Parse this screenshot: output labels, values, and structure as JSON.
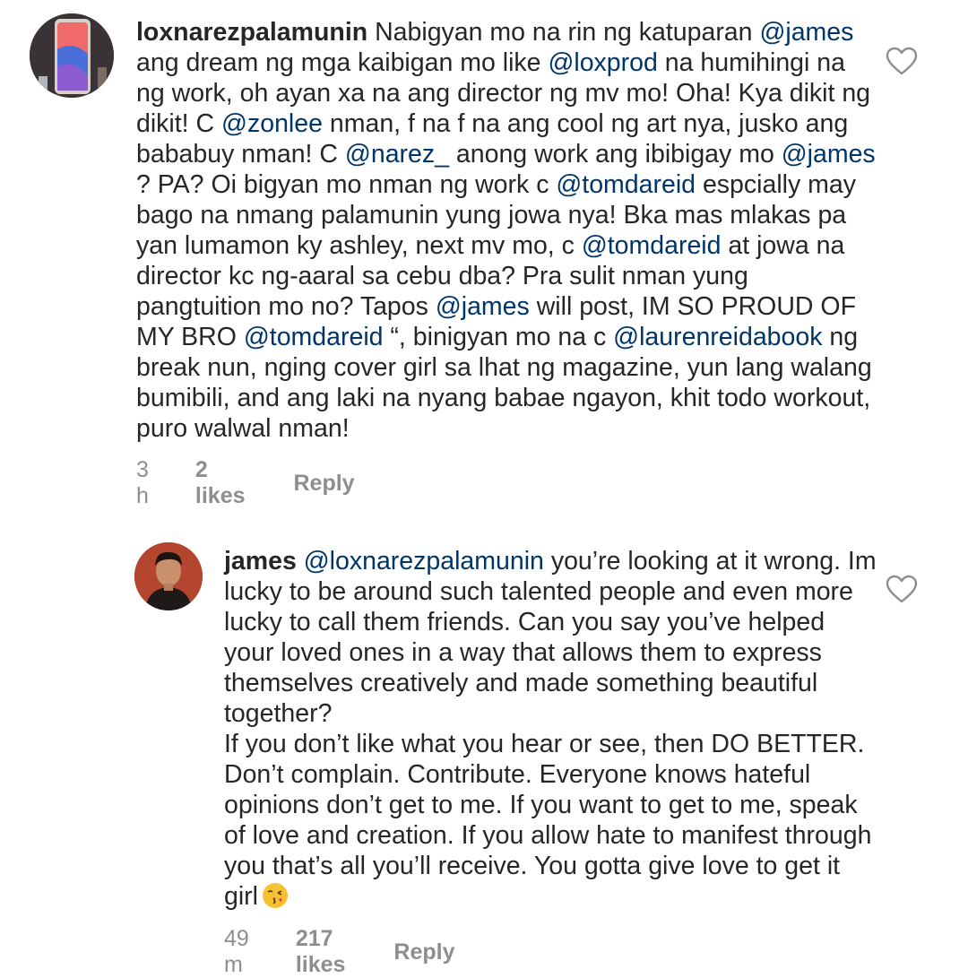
{
  "comments": [
    {
      "username": "loxnarezpalamunin",
      "text_parts": [
        {
          "t": "Nabigyan mo na rin ng katuparan ",
          "m": false
        },
        {
          "t": "@james",
          "m": true
        },
        {
          "t": " ang dream ng mga kaibigan mo like ",
          "m": false
        },
        {
          "t": "@loxprod",
          "m": true
        },
        {
          "t": " na humihingi na ng work, oh ayan xa na ang director ng mv mo! Oha! Kya dikit ng dikit! C ",
          "m": false
        },
        {
          "t": "@zonlee",
          "m": true
        },
        {
          "t": " nman, f na f na ang cool ng art nya, jusko ang bababuy nman! C ",
          "m": false
        },
        {
          "t": "@narez_",
          "m": true
        },
        {
          "t": " anong work ang ibibigay mo ",
          "m": false
        },
        {
          "t": "@james",
          "m": true
        },
        {
          "t": " ? PA? Oi bigyan mo nman ng work c ",
          "m": false
        },
        {
          "t": "@tomdareid",
          "m": true
        },
        {
          "t": " espcially may bago na nmang palamunin yung jowa nya! Bka mas mlakas pa yan lumamon ky ashley, next mv mo, c ",
          "m": false
        },
        {
          "t": "@tomdareid",
          "m": true
        },
        {
          "t": " at jowa na director kc ng-aaral sa cebu dba? Pra sulit nman yung pangtuition mo no? Tapos ",
          "m": false
        },
        {
          "t": "@james",
          "m": true
        },
        {
          "t": " will post, IM SO PROUD OF MY BRO ",
          "m": false
        },
        {
          "t": "@tomdareid",
          "m": true
        },
        {
          "t": " “, binigyan mo na c ",
          "m": false
        },
        {
          "t": "@laurenreidabook",
          "m": true
        },
        {
          "t": " ng break nun, nging cover girl sa lhat ng magazine, yun lang walang bumibili, and ang laki na nyang babae ngayon, khit todo workout, puro walwal nman!",
          "m": false
        }
      ],
      "time": "3 h",
      "likes": "2 likes",
      "reply": "Reply",
      "avatar_icon": "phone-screen-avatar",
      "heart_icon": "heart-outline-icon"
    },
    {
      "username": "james",
      "text_parts": [
        {
          "t": "@loxnarezpalamunin",
          "m": true
        },
        {
          "t": " you’re looking at it wrong. Im lucky to be around such talented people and even more lucky to call them friends. Can you say you’ve helped your loved ones in a way that allows them to express themselves creatively and made something beautiful together?",
          "m": false
        },
        {
          "t": "\nIf you don’t like what you hear or see, then DO BETTER. Don’t complain. Contribute. Everyone knows hateful opinions don’t get to me. If you want to get to me, speak of love and creation. If you allow hate to manifest through you that’s all you’ll receive. You gotta give love to get it girl",
          "m": false
        }
      ],
      "emoji": "kissing-face-emoji",
      "time": "49 m",
      "likes": "217 likes",
      "reply": "Reply",
      "avatar_icon": "profile-photo-avatar",
      "heart_icon": "heart-outline-icon"
    }
  ],
  "colors": {
    "text": "#262626",
    "mention": "#003569",
    "meta": "#8e8e8e"
  }
}
